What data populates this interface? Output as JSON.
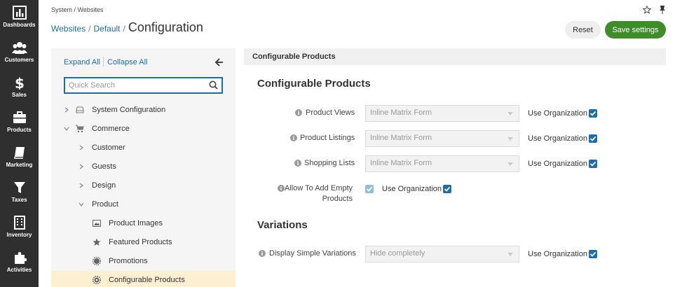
{
  "nav": [
    {
      "id": "dashboards",
      "label": "Dashboards",
      "icon": "bar-chart-icon"
    },
    {
      "id": "customers",
      "label": "Customers",
      "icon": "users-icon"
    },
    {
      "id": "sales",
      "label": "Sales",
      "icon": "dollar-icon"
    },
    {
      "id": "products",
      "label": "Products",
      "icon": "briefcase-icon"
    },
    {
      "id": "marketing",
      "label": "Marketing",
      "icon": "book-icon"
    },
    {
      "id": "taxes",
      "label": "Taxes",
      "icon": "filter-icon"
    },
    {
      "id": "inventory",
      "label": "Inventory",
      "icon": "building-icon"
    },
    {
      "id": "activities",
      "label": "Activities",
      "icon": "puzzle-icon"
    }
  ],
  "header": {
    "breadcrumb_top": "System / Websites",
    "crumbs": [
      "Websites",
      "Default"
    ],
    "title": "Configuration",
    "reset_label": "Reset",
    "save_label": "Save settings"
  },
  "sidebar": {
    "expand_all": "Expand All",
    "collapse_all": "Collapse All",
    "search_placeholder": "Quick Search",
    "tree": [
      {
        "label": "System Configuration",
        "level": 0,
        "chevron": "right",
        "icon": "drive-icon"
      },
      {
        "label": "Commerce",
        "level": 0,
        "chevron": "down",
        "icon": "cart-icon"
      },
      {
        "label": "Customer",
        "level": 1,
        "chevron": "right"
      },
      {
        "label": "Guests",
        "level": 1,
        "chevron": "right"
      },
      {
        "label": "Design",
        "level": 1,
        "chevron": "right"
      },
      {
        "label": "Product",
        "level": 1,
        "chevron": "down"
      },
      {
        "label": "Product Images",
        "level": 2,
        "icon": "image-icon"
      },
      {
        "label": "Featured Products",
        "level": 2,
        "icon": "star-icon"
      },
      {
        "label": "Promotions",
        "level": 2,
        "icon": "cog-icon"
      },
      {
        "label": "Configurable Products",
        "level": 2,
        "icon": "gear-icon",
        "active": true
      }
    ]
  },
  "panel": {
    "header": "Configurable Products",
    "section1_title": "Configurable Products",
    "fields": [
      {
        "label": "Product Views",
        "value": "Inline Matrix Form",
        "use_org": "Use Organization"
      },
      {
        "label": "Product Listings",
        "value": "Inline Matrix Form",
        "use_org": "Use Organization"
      },
      {
        "label": "Shopping Lists",
        "value": "Inline Matrix Form",
        "use_org": "Use Organization"
      }
    ],
    "empty_products": {
      "label_line1": "Allow To Add Empty",
      "label_line2": "Products",
      "use_org": "Use Organization"
    },
    "section2_title": "Variations",
    "variations_field": {
      "label": "Display Simple Variations",
      "value": "Hide completely",
      "use_org": "Use Organization"
    }
  },
  "colors": {
    "accent": "#1c6ea4",
    "save_green": "#3f8c2b",
    "nav_bg": "#2f2f2f",
    "active_row": "#fdf0d2"
  }
}
